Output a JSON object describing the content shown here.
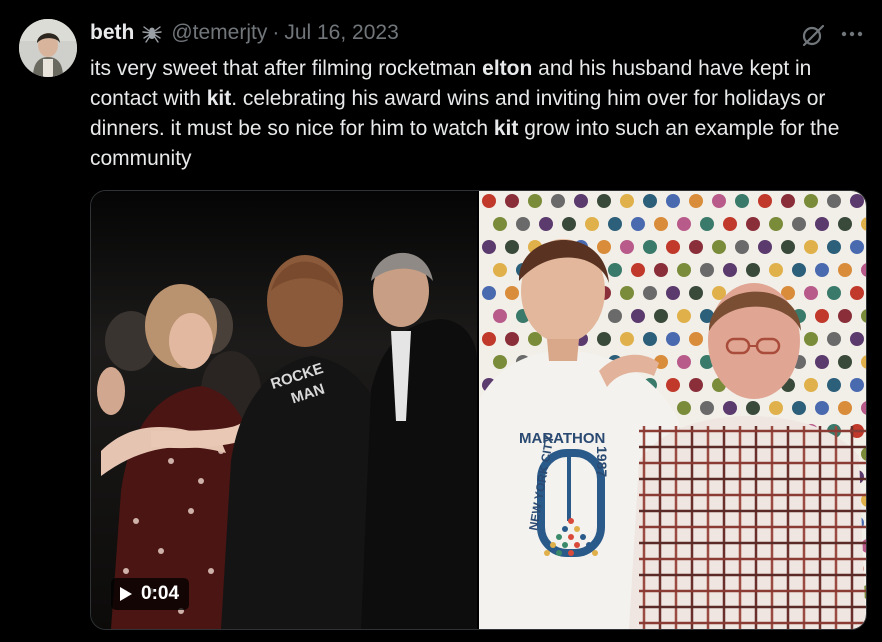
{
  "tweet": {
    "display_name": "beth",
    "handle": "@temerjty",
    "separator": "·",
    "date": "Jul 16, 2023",
    "text_segments": [
      {
        "text": "its very sweet that after filming rocketman ",
        "bold": false
      },
      {
        "text": "elton",
        "bold": true
      },
      {
        "text": " and his husband have kept in contact with ",
        "bold": false
      },
      {
        "text": "kit",
        "bold": true
      },
      {
        "text": ". celebrating his award wins and inviting him over for holidays or dinners. it must be so nice for him to watch ",
        "bold": false
      },
      {
        "text": "kit",
        "bold": true
      },
      {
        "text": " grow into such an example for the community",
        "bold": false
      }
    ]
  },
  "media": {
    "video_duration": "0:04",
    "shirt_text_left": "ROCKE MAN",
    "shirt_text_right": "MARATHON",
    "shirt_city": "NEW YORK CITY",
    "shirt_year": "1987"
  },
  "icons": {
    "badge": "spider-icon",
    "grok": "slash-circle-icon",
    "more": "more-dots-icon",
    "play": "play-icon"
  },
  "colors": {
    "background": "#000000",
    "text": "#e7e9ea",
    "secondary": "#71767b",
    "border": "#2f3336"
  }
}
